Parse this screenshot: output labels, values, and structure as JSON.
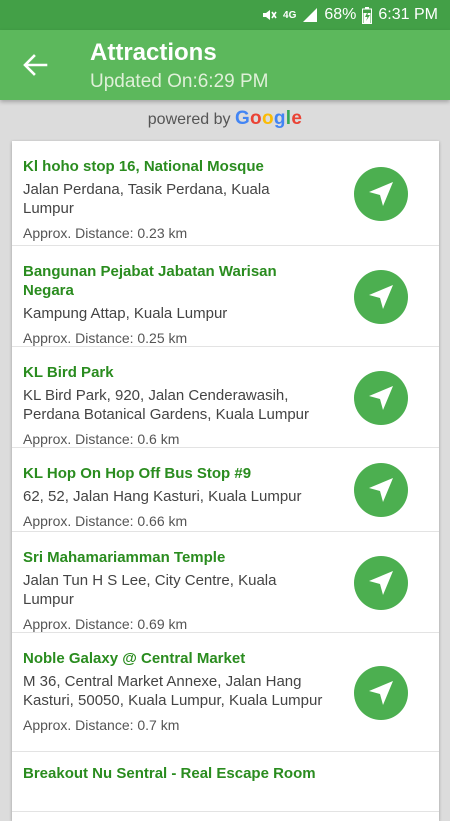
{
  "status": {
    "network": "4G",
    "battery": "68%",
    "time": "6:31 PM"
  },
  "header": {
    "title": "Attractions",
    "subtitle": "Updated On:6:29 PM"
  },
  "powered": {
    "prefix": "powered by",
    "brand": "Google",
    "brand_colors": [
      "#4285F4",
      "#EA4335",
      "#FBBC05",
      "#4285F4",
      "#34A853",
      "#EA4335"
    ]
  },
  "colors": {
    "appbar": "#5cb85c",
    "statusbar": "#43a047",
    "accent": "#2a8c1f",
    "nav_button": "#4caf50"
  },
  "places": [
    {
      "name": "Kl hoho stop 16, National Mosque",
      "address": "Jalan Perdana, Tasik Perdana, Kuala Lumpur",
      "distance": "Approx. Distance: 0.23 km"
    },
    {
      "name": "Bangunan Pejabat Jabatan Warisan Negara",
      "address": "Kampung Attap, Kuala Lumpur",
      "distance": "Approx. Distance: 0.25 km"
    },
    {
      "name": "KL Bird Park",
      "address": "KL Bird Park, 920, Jalan Cenderawasih, Perdana Botanical Gardens, Kuala Lumpur",
      "distance": "Approx. Distance: 0.6 km"
    },
    {
      "name": "KL Hop On Hop Off Bus Stop #9",
      "address": "62, 52, Jalan Hang Kasturi, Kuala Lumpur",
      "distance": "Approx. Distance: 0.66 km"
    },
    {
      "name": "Sri Mahamariamman Temple",
      "address": "Jalan Tun H S Lee, City Centre, Kuala Lumpur",
      "distance": "Approx. Distance: 0.69 km"
    },
    {
      "name": "Noble Galaxy @ Central Market",
      "address": "M 36, Central Market Annexe, Jalan Hang Kasturi, 50050, Kuala Lumpur, Kuala Lumpur",
      "distance": "Approx. Distance: 0.7 km"
    },
    {
      "name": "Breakout Nu Sentral - Real Escape Room",
      "address": "",
      "distance": ""
    }
  ]
}
